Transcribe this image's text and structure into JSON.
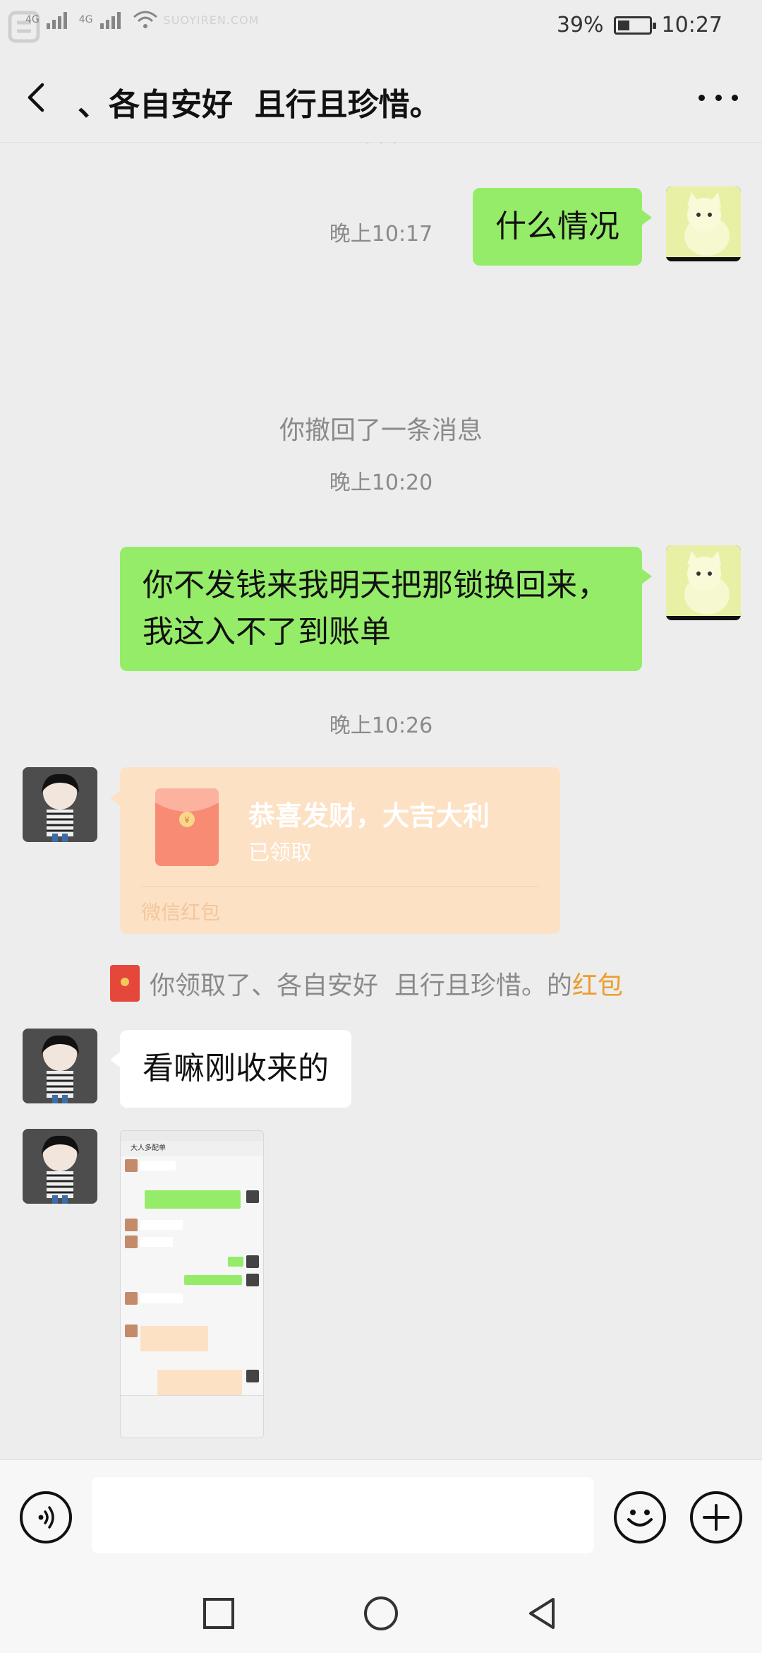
{
  "status_bar": {
    "battery_text": "39%",
    "battery_level": 0.39,
    "time": "10:27",
    "network_1": "4G",
    "network_2": "4G",
    "watermark": "SUOYIREN.COM"
  },
  "header": {
    "title": "、各自安好  且行且珍惜。",
    "back_icon": "chevron-left-icon",
    "more_icon": "more-dots-icon"
  },
  "messages": {
    "msg1": {
      "side": "me",
      "text": "什么情况"
    },
    "ts1": "晚上10:17",
    "recall_notice": "你撤回了一条消息",
    "ts2": "晚上10:20",
    "msg2": {
      "side": "me",
      "text": "你不发钱来我明天把那锁换回来，我这入不了到账单"
    },
    "ts3": "晚上10:26",
    "red_packet": {
      "title": "恭喜发财，大吉大利",
      "status": "已领取",
      "footer": "微信红包"
    },
    "rp_notice": {
      "prefix": "你领取了、各自安好  且行且珍惜。的",
      "link": "红包"
    },
    "msg3": {
      "side": "them",
      "text": "看嘛刚收来的"
    },
    "image_msg": {
      "inner_title": "大人多配单"
    }
  },
  "input_bar": {
    "placeholder": "",
    "voice_icon": "voice-icon",
    "emoji_icon": "emoji-icon",
    "plus_icon": "plus-icon"
  },
  "system_nav": {
    "recent_icon": "square-icon",
    "home_icon": "circle-icon",
    "back_icon": "triangle-back-icon"
  },
  "colors": {
    "bg": "#ededed",
    "my_bubble": "#95ec69",
    "their_bubble": "#ffffff",
    "red_packet": "#fde1c4",
    "link_orange": "#ec9d2c"
  }
}
